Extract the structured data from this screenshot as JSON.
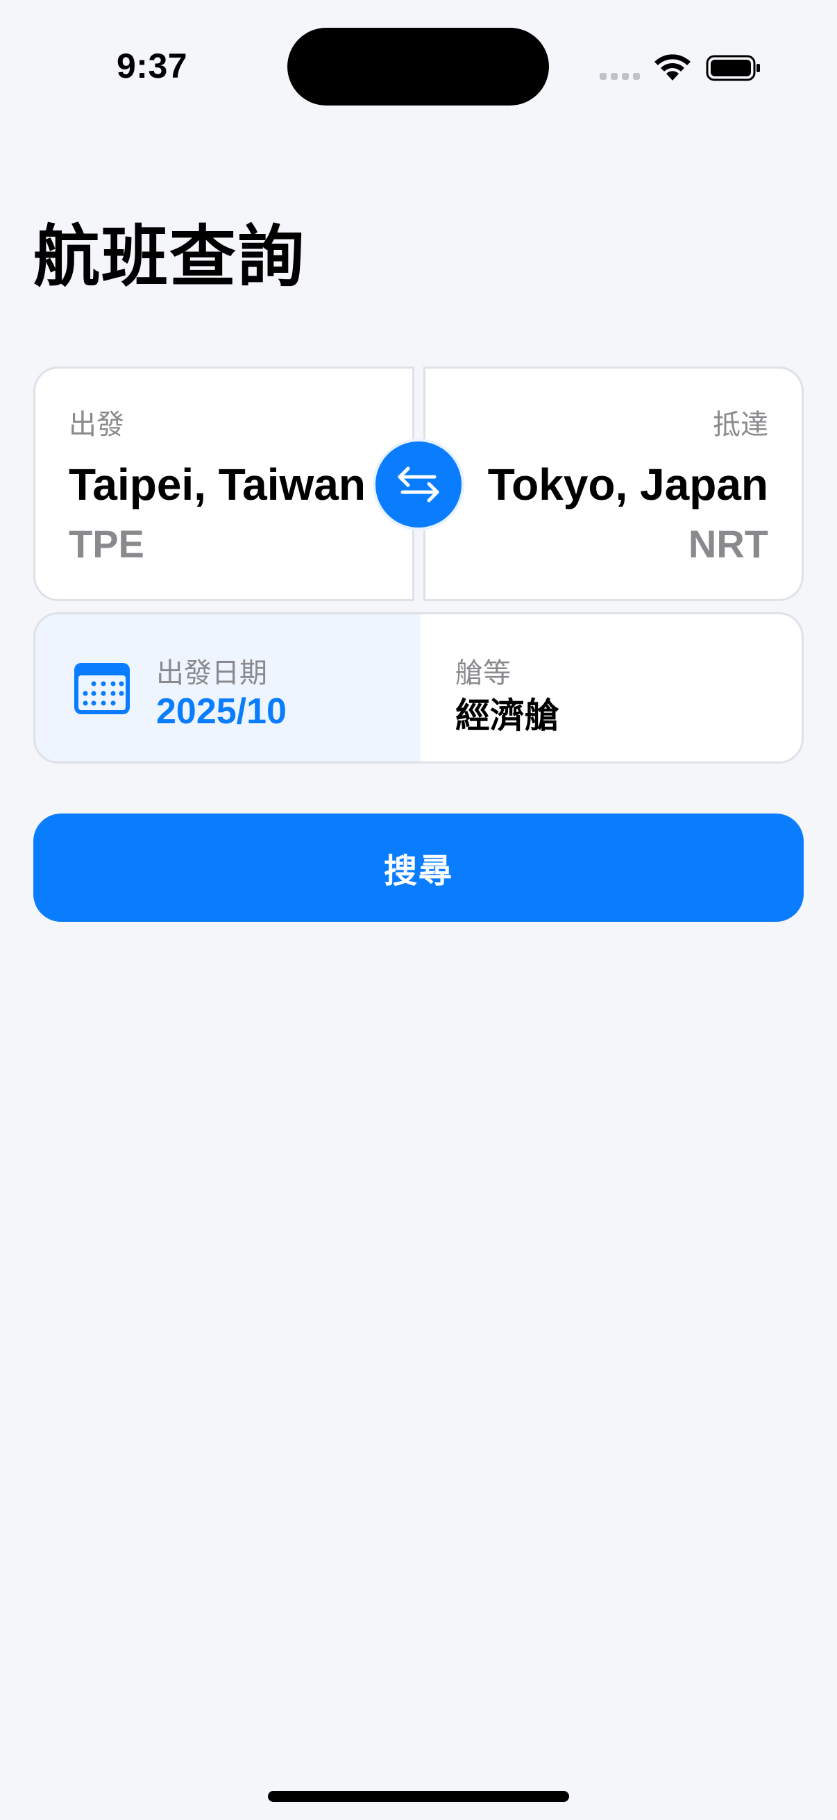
{
  "status_bar": {
    "time": "9:37"
  },
  "page": {
    "title": "航班查詢"
  },
  "route": {
    "from": {
      "label": "出發",
      "city": "Taipei, Taiwan",
      "code": "TPE"
    },
    "to": {
      "label": "抵達",
      "city": "Tokyo, Japan",
      "code": "NRT"
    },
    "swap_icon": "swap-arrows-icon"
  },
  "options": {
    "date": {
      "icon": "calendar-icon",
      "label": "出發日期",
      "value": "2025/10"
    },
    "cabin": {
      "label": "艙等",
      "value": "經濟艙"
    }
  },
  "search": {
    "label": "搜尋"
  },
  "colors": {
    "accent": "#0A7DFF",
    "background": "#F4F6FA",
    "secondary_text": "#8A8A8E",
    "date_panel_bg": "#EEF5FF"
  }
}
